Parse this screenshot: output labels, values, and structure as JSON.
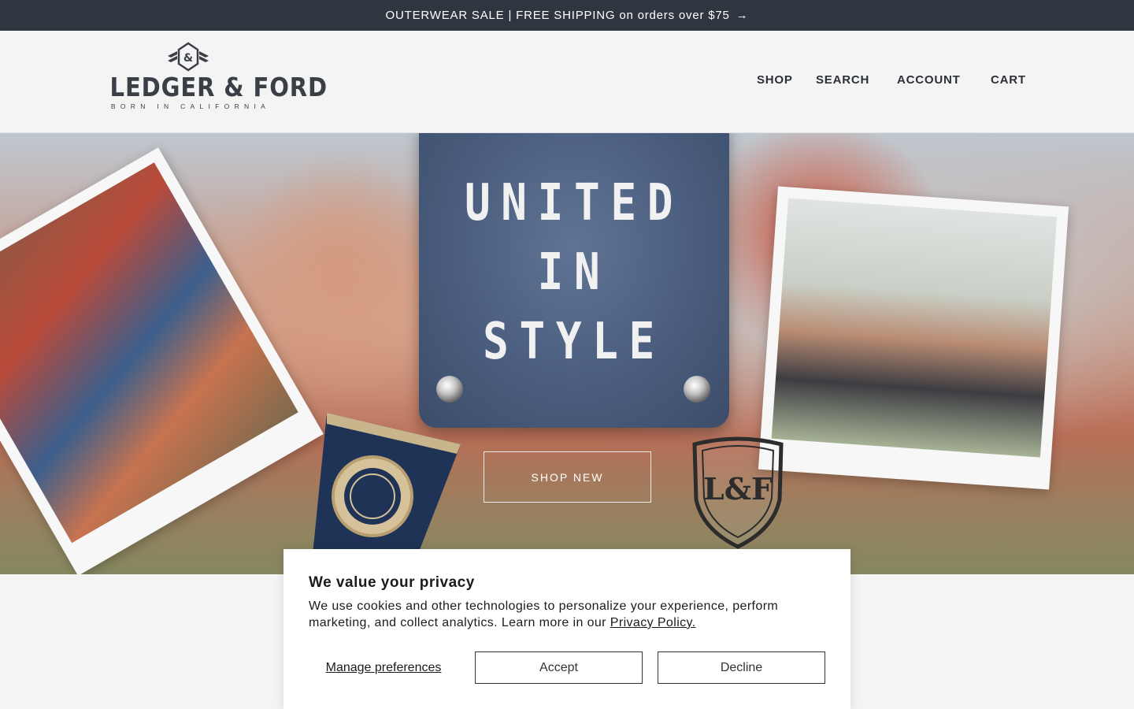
{
  "announcement": {
    "text": "OUTERWEAR SALE | FREE SHIPPING on orders over $75",
    "arrow_icon": "→"
  },
  "brand": {
    "monogram": "&",
    "name": "LEDGER & FORD",
    "tagline": "BORN IN CALIFORNIA"
  },
  "nav": {
    "shop": "SHOP",
    "search": "SEARCH",
    "account": "ACCOUNT",
    "cart": "CART"
  },
  "hero": {
    "headline_lines": [
      "UNITED",
      "IN",
      "STYLE"
    ],
    "cta": "SHOP NEW",
    "shield_text": "L&F"
  },
  "privacy_banner": {
    "title": "We value your privacy",
    "body": "We use cookies and other technologies to personalize your experience, perform marketing, and collect analytics. Learn more in our ",
    "policy_link": "Privacy Policy.",
    "manage": "Manage preferences",
    "accept": "Accept",
    "decline": "Decline"
  },
  "colors": {
    "announcement_bg": "#2f3640",
    "nav_text": "#2b2f36",
    "patch_blue": "#4a5d7e",
    "page_bg": "#f4f4f4"
  }
}
